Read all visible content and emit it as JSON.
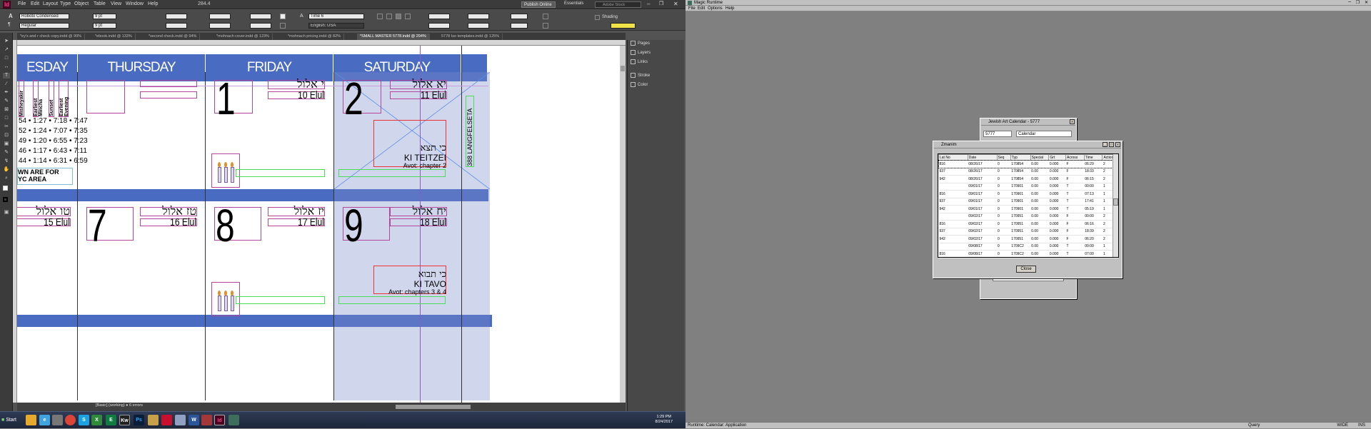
{
  "indesign": {
    "menu": [
      "File",
      "Edit",
      "Layout",
      "Type",
      "Object",
      "Table",
      "View",
      "Window",
      "Help"
    ],
    "zoom": "284.4",
    "publish_online": "Publish Online",
    "workspace": "Essentials",
    "search_placeholder": "Adobe Stock",
    "font_family": "Roboto Condensed",
    "font_style": "Regular",
    "font_size": "9 pt",
    "leading": "9 pt",
    "para_style": "Time 6",
    "language": "English: USA",
    "shading": "Shading",
    "tabs": [
      "*ey's and r check copy.indd @ 99%",
      "*ebook.indd @ 133%",
      "*second check.indd @ 94%",
      "*mohnach cover.indd @ 123%",
      "*mohnach pricing.indd @ 82%",
      "*SMALL MASTER 5778.indd @ 294%",
      "5778 Iso templates.indd @ 125%"
    ],
    "panels": [
      "Pages",
      "Layers",
      "Links",
      "Stroke",
      "Color"
    ],
    "status": "[Basic] (working)  ● 6 errors",
    "calendar": {
      "days": [
        "ESDAY",
        "THURSDAY",
        "FRIDAY",
        "SATURDAY"
      ],
      "zmanim_headers": [
        "Misheyakir",
        "Earliest Mincha",
        "Sunset",
        "Earliest Evening"
      ],
      "zmanim_rows": [
        "54 • 1:27 • 7:18 • 7:47",
        "52 • 1:24 • 7:07 • 7:35",
        "49 • 1:20 • 6:55 • 7:23",
        "46 • 1:17 • 6:43 • 7:11",
        "44 • 1:14 • 6:31 • 6:59"
      ],
      "note": "WN ARE FOR \nYC AREA",
      "side_text": "388 LANGFELSETA",
      "week1": {
        "fri": {
          "num": "1",
          "heb": "י אלול",
          "eng": "10 Elul"
        },
        "sat": {
          "num": "2",
          "heb": "יא אלול",
          "eng": "11 Elul",
          "p1": "כי תצא",
          "p2": "KI TEITZEI",
          "p3": "Avot: chapter 2"
        }
      },
      "week2": {
        "wed": {
          "heb": "טו אלול",
          "eng": "15 Elul"
        },
        "thu": {
          "num": "7",
          "heb": "טז אלול",
          "eng": "16 Elul"
        },
        "fri": {
          "num": "8",
          "heb": "יז אלול",
          "eng": "17 Elul"
        },
        "sat": {
          "num": "9",
          "heb": "יח אלול",
          "eng": "18 Elul",
          "p1": "כי תבוא",
          "p2": "KI TAVO",
          "p3": "Avot: chapters 3 & 4"
        }
      }
    }
  },
  "taskbar": {
    "start": "Start",
    "apps": [
      "Explorer",
      "Chrome",
      "Folder",
      "VLC",
      "Chrome",
      "Skype",
      "Excel",
      "Kw",
      "Photoshop",
      "Files",
      "Acrobat",
      "Notepad",
      "Word",
      "Access",
      "InDesign",
      "App"
    ],
    "time": "1:29 PM",
    "date": "8/24/2017"
  },
  "magic": {
    "title": "Magic Runtime",
    "menu": [
      "File",
      "Edit",
      "Options",
      "Help"
    ],
    "status_left": "Runtime: Calendar: Application",
    "status_query": "Query",
    "status_wide": "WIDE",
    "status_ins": "INS",
    "calwin": {
      "title": "Jewish Art Calendar - 5777",
      "year": "5777",
      "type": "Calendar"
    },
    "zmanim": {
      "title": "Zmanim",
      "columns": [
        "Lat No",
        "Date",
        "Seq",
        "Typ",
        "Special",
        "Grt",
        "Across",
        "Time",
        "Action"
      ],
      "rows": [
        [
          "816",
          "08/26/17",
          "0",
          "170854",
          "0.00",
          "0.000",
          "F",
          "06:29",
          "2"
        ],
        [
          "937",
          "08/26/17",
          "0",
          "170854",
          "0.00",
          "0.000",
          "F",
          "18:33",
          "2"
        ],
        [
          "942",
          "08/26/17",
          "0",
          "170854",
          "0.00",
          "0.000",
          "F",
          "06:15",
          "2"
        ],
        [
          "",
          "09/01/17",
          "0",
          "170901",
          "0.00",
          "0.000",
          "T",
          "00:00",
          "1"
        ],
        [
          "816",
          "09/01/17",
          "0",
          "170901",
          "0.00",
          "0.000",
          "T",
          "07:13",
          "1"
        ],
        [
          "937",
          "09/01/17",
          "0",
          "170901",
          "0.00",
          "0.000",
          "T",
          "17:41",
          "1"
        ],
        [
          "942",
          "09/01/17",
          "0",
          "170901",
          "0.00",
          "0.000",
          "T",
          "05:19",
          "1"
        ],
        [
          "",
          "09/02/17",
          "0",
          "170951",
          "0.00",
          "0.000",
          "F",
          "00:00",
          "2"
        ],
        [
          "816",
          "09/02/17",
          "0",
          "170951",
          "0.00",
          "0.000",
          "F",
          "06:16",
          "2"
        ],
        [
          "937",
          "09/02/17",
          "0",
          "170951",
          "0.00",
          "0.000",
          "F",
          "18:39",
          "2"
        ],
        [
          "942",
          "09/02/17",
          "0",
          "170951",
          "0.00",
          "0.000",
          "F",
          "06:20",
          "2"
        ],
        [
          "",
          "09/08/17",
          "0",
          "1709C2",
          "0.00",
          "0.000",
          "T",
          "00:00",
          "1"
        ],
        [
          "816",
          "09/08/17",
          "0",
          "1709C2",
          "0.00",
          "0.000",
          "T",
          "07:00",
          "1"
        ]
      ],
      "close": "Close"
    }
  }
}
